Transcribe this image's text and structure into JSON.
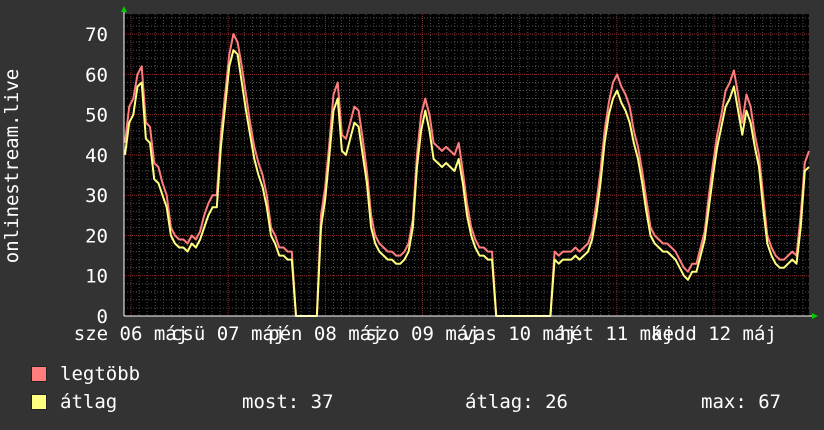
{
  "chart_data": {
    "type": "line",
    "ylabel": "onlinestream.live",
    "ylim": [
      0,
      75
    ],
    "yticks": [
      0,
      10,
      20,
      30,
      40,
      50,
      60,
      70
    ],
    "x_tick_labels": [
      "sze 06 máj",
      "csü 07 máj",
      "pén 08 máj",
      "szo 09 máj",
      "vas 10 máj",
      "hét 11 máj",
      "kedd 12 máj"
    ],
    "grid": true,
    "series": [
      {
        "name": "legtöbb",
        "color": "#ff7d7d",
        "values": [
          43,
          52,
          54,
          60,
          62,
          48,
          47,
          38,
          37,
          33,
          30,
          22,
          20,
          19,
          19,
          18,
          20,
          19,
          21,
          25,
          28,
          30,
          30,
          45,
          55,
          65,
          70,
          68,
          62,
          55,
          48,
          42,
          38,
          35,
          30,
          22,
          20,
          17,
          17,
          16,
          16,
          0,
          0,
          0,
          0,
          0,
          0,
          25,
          32,
          43,
          55,
          58,
          45,
          44,
          48,
          52,
          51,
          44,
          36,
          25,
          20,
          18,
          17,
          16,
          16,
          15,
          15,
          16,
          18,
          24,
          40,
          50,
          54,
          50,
          43,
          42,
          41,
          42,
          41,
          40,
          43,
          36,
          28,
          22,
          19,
          17,
          17,
          16,
          16,
          0,
          0,
          0,
          0,
          0,
          0,
          0,
          0,
          0,
          0,
          0,
          0,
          0,
          0,
          16,
          15,
          16,
          16,
          16,
          17,
          16,
          17,
          18,
          21,
          28,
          36,
          46,
          53,
          58,
          60,
          57,
          55,
          52,
          46,
          42,
          36,
          29,
          22,
          20,
          19,
          18,
          18,
          17,
          16,
          14,
          12,
          11,
          13,
          13,
          17,
          21,
          30,
          38,
          45,
          50,
          56,
          58,
          61,
          55,
          48,
          55,
          52,
          45,
          40,
          30,
          20,
          17,
          15,
          14,
          14,
          15,
          16,
          15,
          25,
          38,
          41
        ]
      },
      {
        "name": "átlag",
        "color": "#ffff80",
        "values": [
          40,
          48,
          50,
          57,
          58,
          44,
          43,
          34,
          33,
          30,
          27,
          20,
          18,
          17,
          17,
          16,
          18,
          17,
          19,
          22,
          25,
          27,
          27,
          42,
          52,
          62,
          66,
          65,
          58,
          51,
          45,
          39,
          35,
          32,
          27,
          20,
          18,
          15,
          15,
          14,
          14,
          0,
          0,
          0,
          0,
          0,
          0,
          22,
          29,
          40,
          51,
          54,
          41,
          40,
          44,
          48,
          47,
          40,
          33,
          22,
          18,
          16,
          15,
          14,
          14,
          13,
          13,
          14,
          16,
          22,
          37,
          46,
          51,
          46,
          39,
          38,
          37,
          38,
          37,
          36,
          39,
          33,
          25,
          20,
          17,
          15,
          15,
          14,
          14,
          0,
          0,
          0,
          0,
          0,
          0,
          0,
          0,
          0,
          0,
          0,
          0,
          0,
          0,
          14,
          13,
          14,
          14,
          14,
          15,
          14,
          15,
          16,
          19,
          25,
          33,
          43,
          50,
          54,
          56,
          53,
          51,
          48,
          43,
          39,
          33,
          26,
          20,
          18,
          17,
          16,
          16,
          15,
          14,
          12,
          10,
          9,
          11,
          11,
          15,
          19,
          27,
          35,
          42,
          47,
          52,
          54,
          57,
          51,
          45,
          51,
          48,
          42,
          37,
          27,
          18,
          15,
          13,
          12,
          12,
          13,
          14,
          13,
          22,
          36,
          37
        ]
      }
    ]
  },
  "legend": {
    "max_label": "legtöbb",
    "avg_label": "átlag",
    "now_text": "most: 37",
    "average_text": "átlag: 26",
    "maximum_text": "max: 67"
  },
  "colors": {
    "background": "#333333",
    "plot_background": "#000000",
    "grid_major": "#8a2a2a",
    "grid_minor": "#505050",
    "arrow": "#00cc00"
  }
}
